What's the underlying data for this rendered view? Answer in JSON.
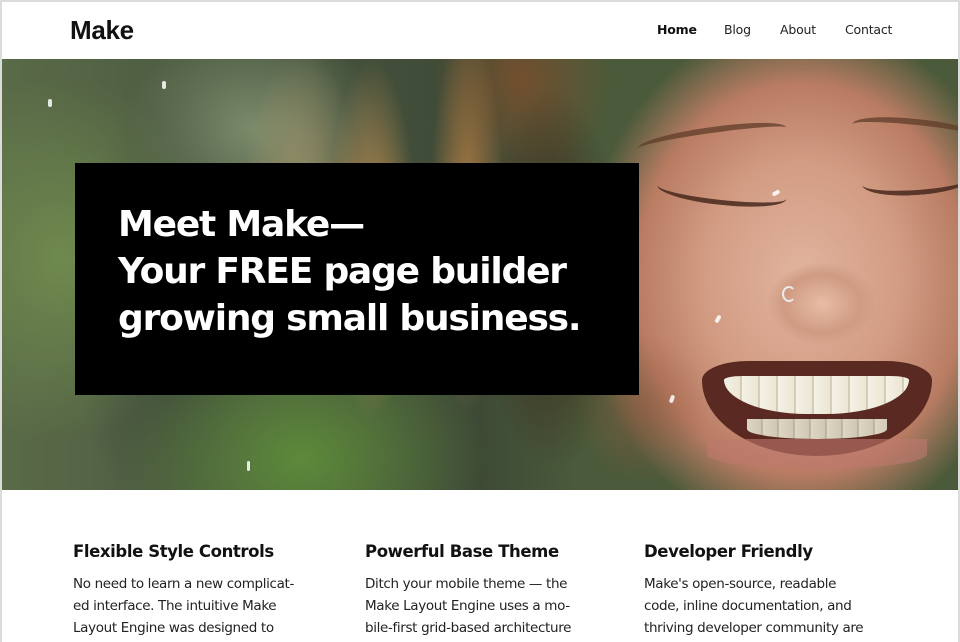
{
  "header": {
    "logo": "Make",
    "nav": [
      {
        "label": "Home",
        "active": true
      },
      {
        "label": "Blog",
        "active": false
      },
      {
        "label": "About",
        "active": false
      },
      {
        "label": "Contact",
        "active": false
      }
    ]
  },
  "hero": {
    "image": "photo of a laughing woman with closed eyes, water droplets, green blurred background",
    "title_lines": [
      "Meet Make—",
      "Your FREE page builder",
      "growing small business."
    ],
    "box_color": "#000000",
    "text_color": "#ffffff"
  },
  "features": [
    {
      "title": "Flexible Style Controls",
      "lines": [
        "No need to learn a new complicat-",
        "ed interface. The intuitive Make",
        "Layout Engine was designed to"
      ]
    },
    {
      "title": "Powerful Base Theme",
      "lines": [
        "Ditch your mobile theme — the",
        "Make Layout Engine uses a mo-",
        "bile-first grid-based architecture"
      ]
    },
    {
      "title": "Developer Friendly",
      "lines": [
        "Make's open-source, readable",
        "code, inline documentation, and",
        "thriving developer community are"
      ]
    }
  ]
}
